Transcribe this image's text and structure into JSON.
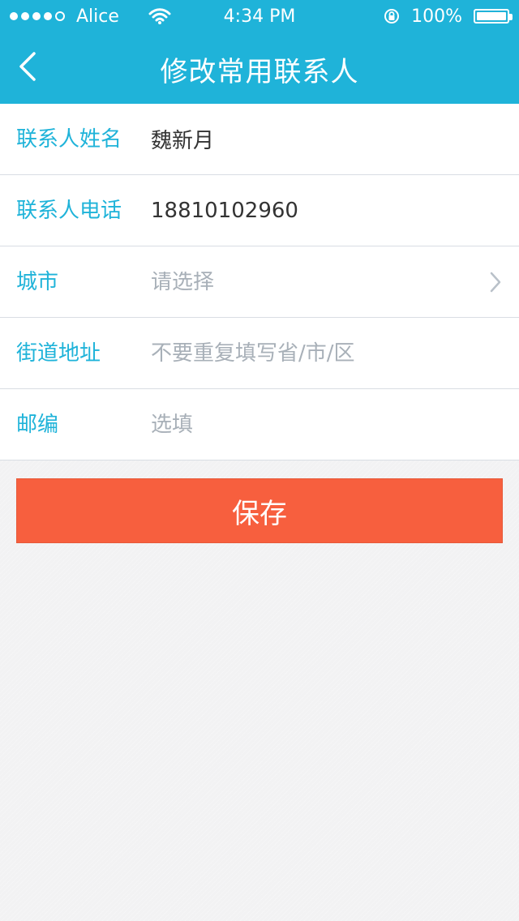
{
  "status_bar": {
    "carrier": "Alice",
    "time": "4:34 PM",
    "battery_percent": "100%"
  },
  "header": {
    "title": "修改常用联系人"
  },
  "form": {
    "rows": [
      {
        "label": "联系人姓名",
        "value": "魏新月",
        "placeholder": ""
      },
      {
        "label": "联系人电话",
        "value": "18810102960",
        "placeholder": ""
      },
      {
        "label": "城市",
        "value": "",
        "placeholder": "请选择"
      },
      {
        "label": "街道地址",
        "value": "",
        "placeholder": "不要重复填写省/市/区"
      },
      {
        "label": "邮编",
        "value": "",
        "placeholder": "选填"
      }
    ]
  },
  "actions": {
    "save_label": "保存"
  },
  "colors": {
    "accent": "#1fb3d9",
    "save": "#f75f3e",
    "placeholder": "#a8b0b8"
  },
  "icons": {
    "back": "chevron-left-icon",
    "city_chevron": "chevron-right-icon",
    "wifi": "wifi-icon",
    "lock": "orientation-lock-icon",
    "battery": "battery-icon"
  }
}
